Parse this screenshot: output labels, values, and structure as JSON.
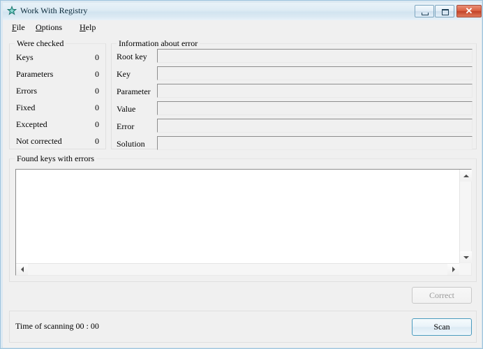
{
  "window": {
    "title": "Work With Registry",
    "icon": "star-icon",
    "controls": {
      "minimize": "minimize-icon",
      "maximize": "maximize-icon",
      "close": "✕"
    }
  },
  "menubar": {
    "items": [
      {
        "label": "File",
        "accel": "F",
        "rest": "ile"
      },
      {
        "label": "Options",
        "accel": "O",
        "rest": "ptions"
      },
      {
        "label": "Help",
        "accel": "H",
        "rest": "elp"
      }
    ]
  },
  "were_checked": {
    "title": "Were checked",
    "rows": [
      {
        "label": "Keys",
        "value": "0"
      },
      {
        "label": "Parameters",
        "value": "0"
      },
      {
        "label": "Errors",
        "value": "0"
      },
      {
        "label": "Fixed",
        "value": "0"
      },
      {
        "label": "Excepted",
        "value": "0"
      },
      {
        "label": "Not corrected",
        "value": "0"
      }
    ]
  },
  "information_about_error": {
    "title": "Information about error",
    "fields": [
      {
        "label": "Root key",
        "value": ""
      },
      {
        "label": "Key",
        "value": ""
      },
      {
        "label": "Parameter",
        "value": ""
      },
      {
        "label": "Value",
        "value": ""
      },
      {
        "label": "Error",
        "value": ""
      },
      {
        "label": "Solution",
        "value": ""
      }
    ]
  },
  "found_keys": {
    "title": "Found keys with errors",
    "items": [],
    "scrollbars": {
      "vertical": {
        "up": "scroll-up-icon",
        "down": "scroll-down-icon"
      },
      "horizontal": {
        "left": "scroll-left-icon",
        "right": "scroll-right-icon"
      }
    }
  },
  "actions": {
    "correct_label": "Correct",
    "correct_enabled": false,
    "scan_label": "Scan",
    "scan_enabled": true
  },
  "status": {
    "text": "Time of scanning   00 : 00",
    "label": "Time of scanning",
    "time": "00 : 00"
  },
  "colors": {
    "close_button": "#c2432a",
    "scan_focus_border": "#4a9bbe",
    "window_border": "#9dc4dd",
    "client_background": "#f0f0f0"
  }
}
